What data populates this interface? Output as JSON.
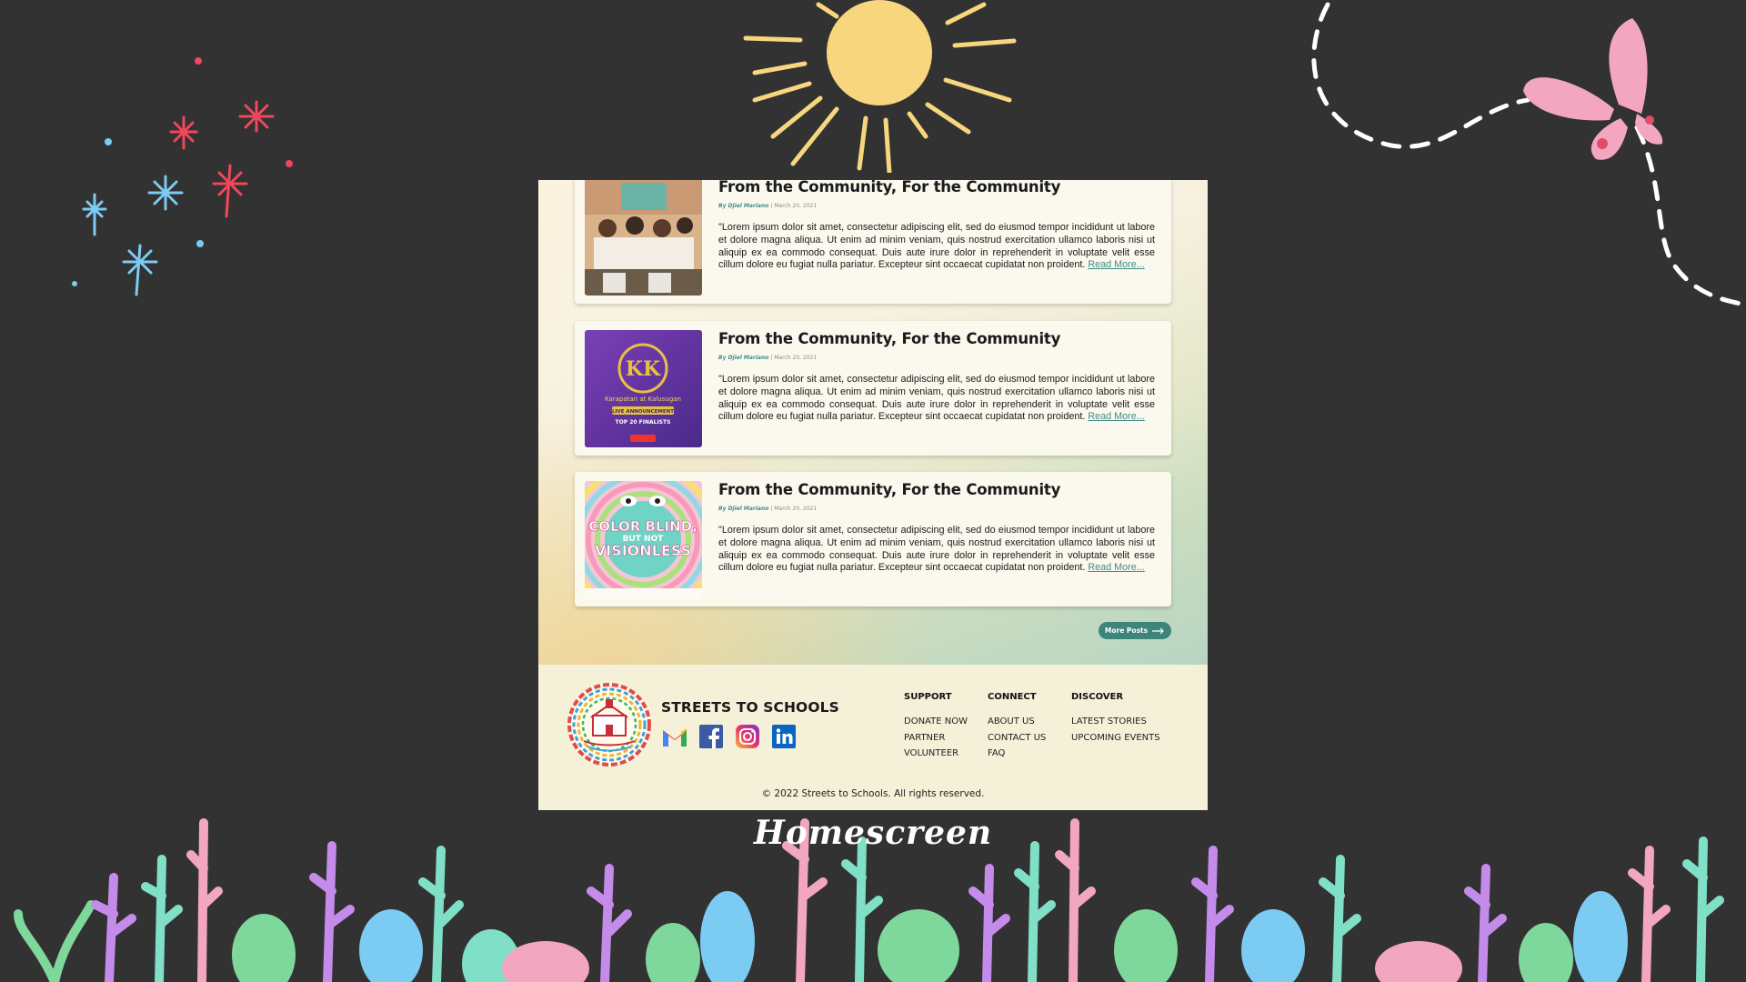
{
  "posts": [
    {
      "title": "From the Community, For the Community",
      "author": "By Djiel Mariano",
      "separator": "|",
      "date": "March 20, 2021",
      "excerpt": "\"Lorem ipsum dolor sit amet, consectetur adipiscing elit, sed do eiusmod tempor incididunt ut labore et dolore magna aliqua. Ut enim ad minim veniam, quis nostrud exercitation ullamco laboris nisi ut aliquip ex ea commodo consequat. Duis aute irure dolor in reprehenderit in voluptate velit esse cillum dolore eu fugiat nulla pariatur. Excepteur sint occaecat cupidatat non proident.",
      "read_more": "Read More..."
    },
    {
      "title": "From the Community, For the Community",
      "author": "By Djiel Mariano",
      "separator": "|",
      "date": "March 20, 2021",
      "excerpt": "\"Lorem ipsum dolor sit amet, consectetur adipiscing elit, sed do eiusmod tempor incididunt ut labore et dolore magna aliqua. Ut enim ad minim veniam, quis nostrud exercitation ullamco laboris nisi ut aliquip ex ea commodo consequat. Duis aute irure dolor in reprehenderit in voluptate velit esse cillum dolore eu fugiat nulla pariatur. Excepteur sint occaecat cupidatat non proident.",
      "read_more": "Read More..."
    },
    {
      "title": "From the Community, For the Community",
      "author": "By Djiel Mariano",
      "separator": "|",
      "date": "March 20, 2021",
      "excerpt": "\"Lorem ipsum dolor sit amet, consectetur adipiscing elit, sed do eiusmod tempor incididunt ut labore et dolore magna aliqua. Ut enim ad minim veniam, quis nostrud exercitation ullamco laboris nisi ut aliquip ex ea commodo consequat. Duis aute irure dolor in reprehenderit in voluptate velit esse cillum dolore eu fugiat nulla pariatur. Excepteur sint occaecat cupidatat non proident.",
      "read_more": "Read More..."
    }
  ],
  "thumbnails": {
    "post2_text": "Karapatan at Kalusugan",
    "post2_badge": "LIVE ANNOUNCEMENT",
    "post2_sub": "TOP 20 FINALISTS",
    "post3_line1": "COLOR BLIND,",
    "post3_line2": "BUT NOT",
    "post3_line3": "VISIONLESS"
  },
  "more_posts_label": "More Posts",
  "footer": {
    "org_name": "STREETS TO SCHOOLS",
    "columns": [
      {
        "heading": "SUPPORT",
        "links": [
          "DONATE NOW",
          "PARTNER",
          "VOLUNTEER"
        ]
      },
      {
        "heading": "CONNECT",
        "links": [
          "ABOUT US",
          "CONTACT US",
          "FAQ"
        ]
      },
      {
        "heading": "DISCOVER",
        "links": [
          "LATEST STORIES",
          "UPCOMING EVENTS"
        ]
      }
    ],
    "socials": [
      "gmail-icon",
      "facebook-icon",
      "instagram-icon",
      "linkedin-icon"
    ],
    "copyright": "© 2022 Streets to Schools. All rights reserved."
  },
  "caption": "Homescreen",
  "colors": {
    "background": "#323232",
    "accent_teal": "#3d8479",
    "sun": "#f7d67e",
    "pink": "#f2a6c0",
    "red_spark": "#f0475a",
    "blue_spark": "#7ccbf2"
  }
}
